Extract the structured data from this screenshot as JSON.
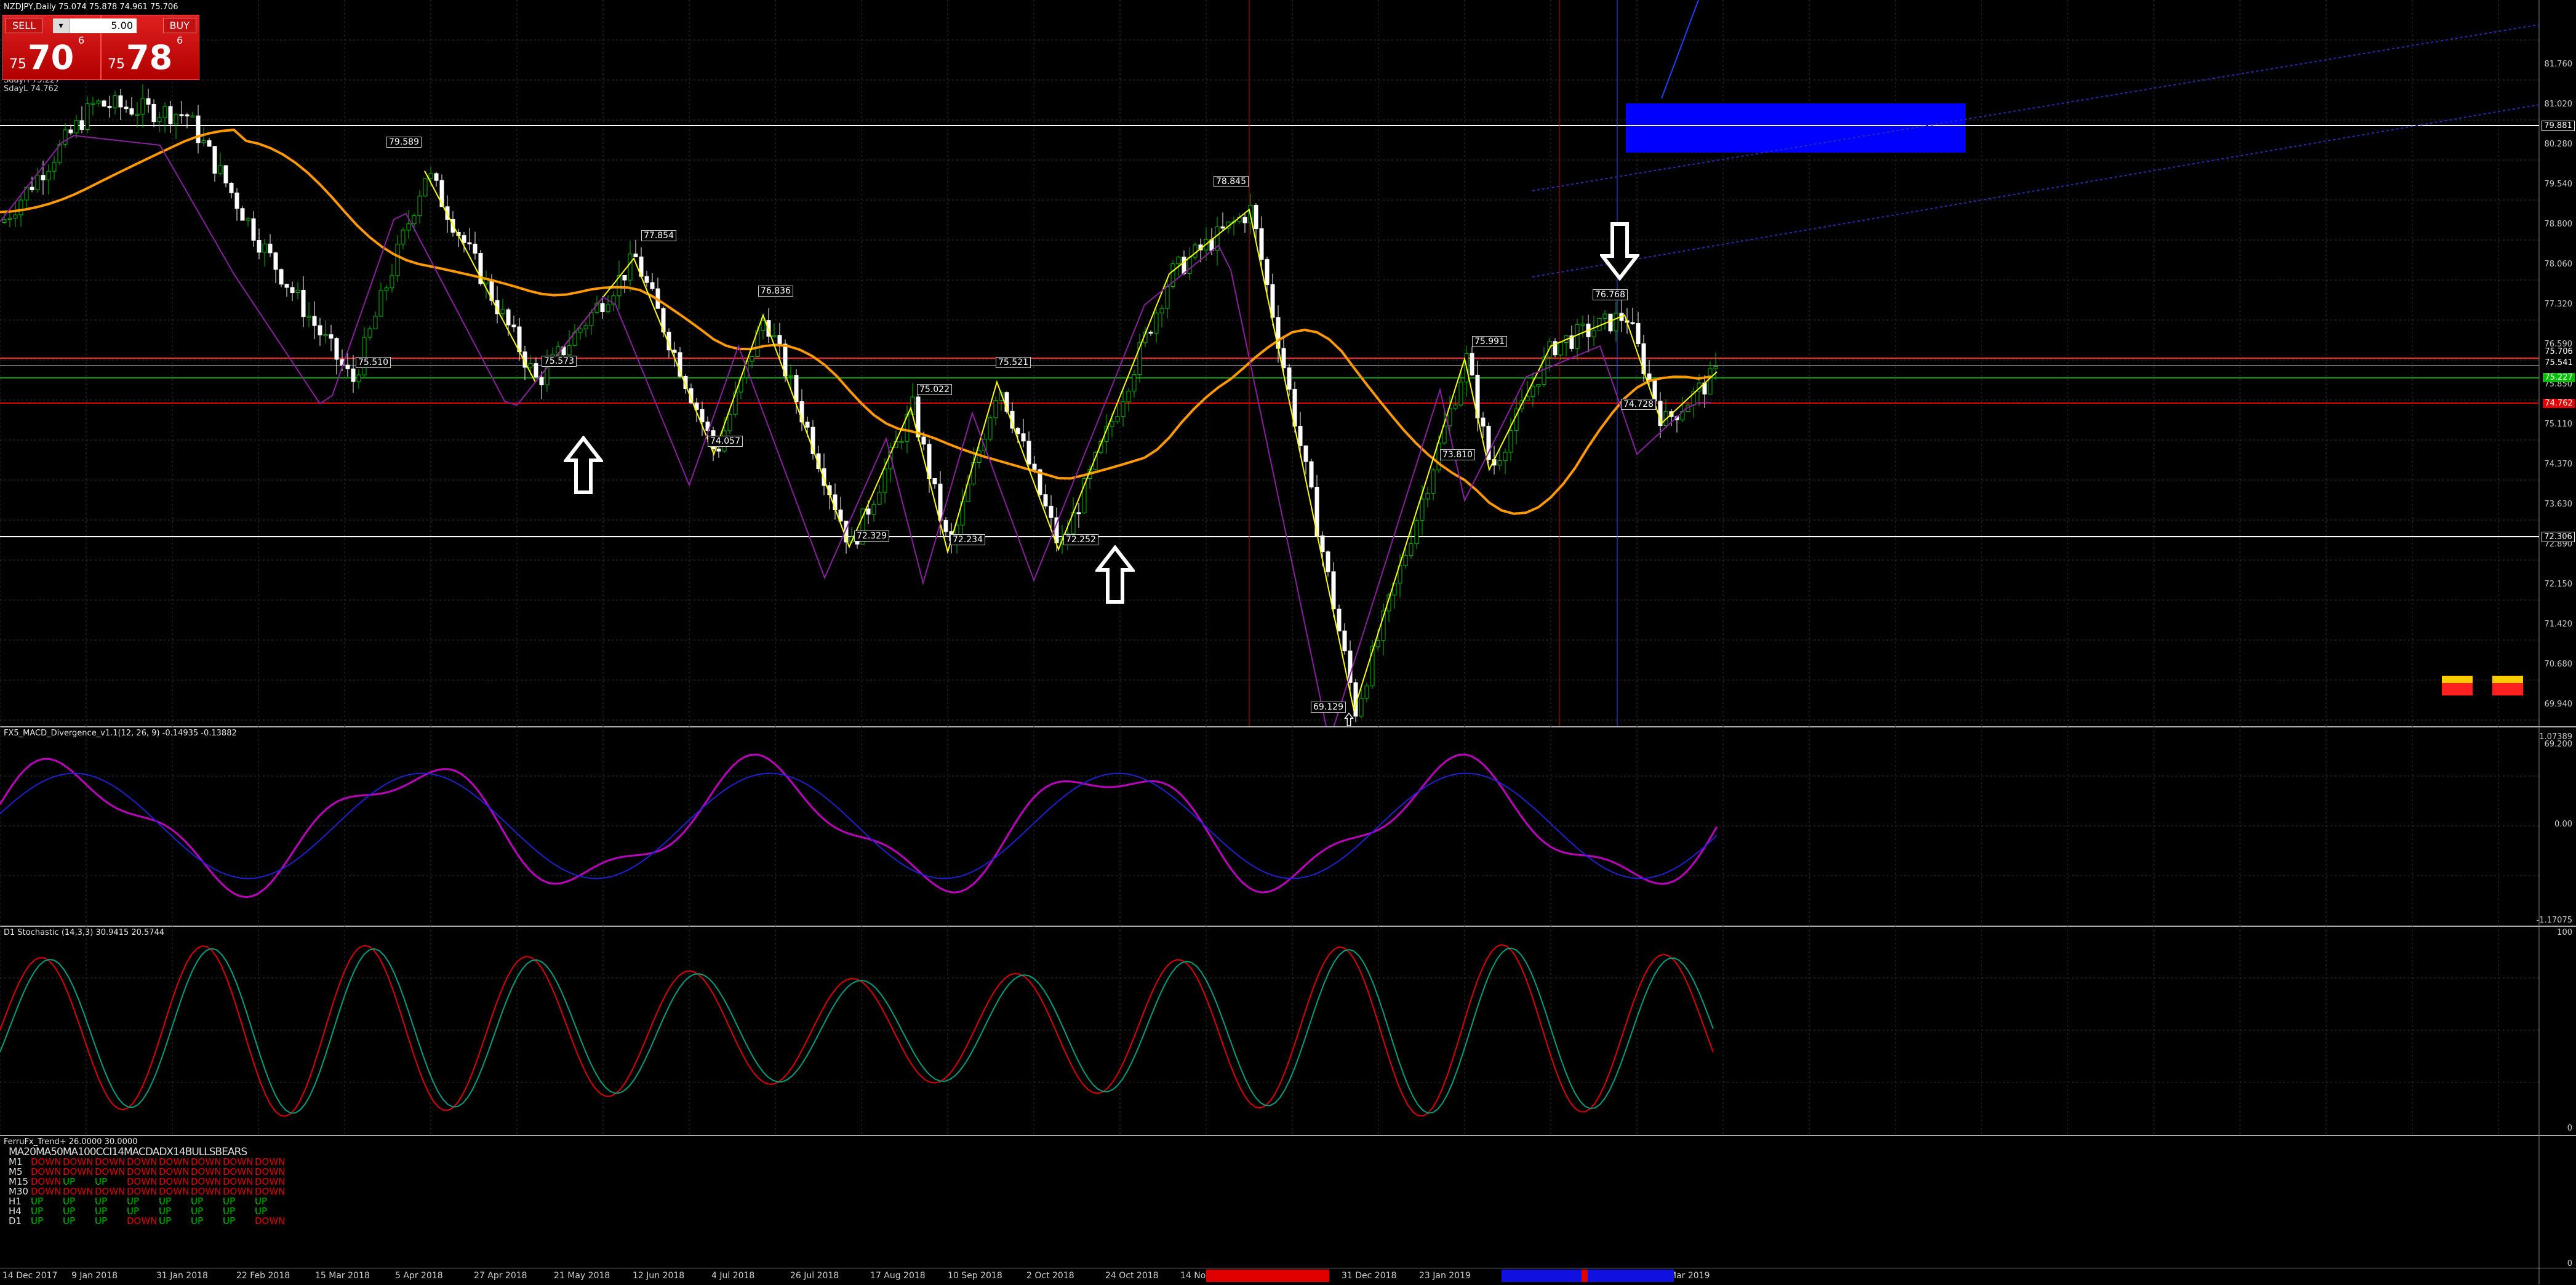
{
  "symbol_header": "NZDJPY,Daily  75.074 75.878 74.961 75.706",
  "trade_panel": {
    "sell_label": "SELL",
    "buy_label": "BUY",
    "lot": "5.00",
    "sell_small": "75",
    "sell_big": "70",
    "sell_sup": "6",
    "buy_small": "75",
    "buy_big": "78",
    "buy_sup": "6"
  },
  "sd_lines": [
    "SdayH 75.227",
    "SdayL 74.762"
  ],
  "price_axis": [
    "81.760",
    "81.020",
    "80.280",
    "79.540",
    "78.800",
    "78.060",
    "77.320",
    "76.590",
    "75.850",
    "75.110",
    "74.370",
    "73.630",
    "72.890",
    "72.150",
    "71.420",
    "70.680",
    "69.940",
    "69.200"
  ],
  "price_tags": {
    "top": "79.881",
    "current": "75.706",
    "line2": "75.541",
    "green": "75.227",
    "red": "74.762",
    "low": "72.306"
  },
  "zigzag_labels": [
    "79.589",
    "75.510",
    "77.854",
    "75.573",
    "76.836",
    "74.057",
    "75.022",
    "72.329",
    "72.234",
    "75.521",
    "72.252",
    "78.845",
    "69.129",
    "75.991",
    "73.810",
    "76.768",
    "74.728"
  ],
  "colors": {
    "bull_candle": "#00c000",
    "bear_candle": "#ffffff",
    "ma_orange": "#ff9900",
    "zigzag_yellow": "#ffff00",
    "zigzag_blue": "#3a70ff",
    "zigzag_red": "#ff2060",
    "rect_blue": "#0000ff",
    "macd_main": "#c000c0",
    "macd_signal": "#2020d0",
    "stoch_main": "#e00000",
    "stoch_signal": "#00a080"
  },
  "macd": {
    "title": "FX5_MACD_Divergence_v1.1(12, 26, 9) -0.14935 -0.13882",
    "axis": [
      "1.07389",
      "0.00",
      "-1.17075"
    ]
  },
  "stoch": {
    "title": "D1 Stochastic (14,3,3) 30.9415 20.5744",
    "axis": [
      "100",
      "0"
    ]
  },
  "trend": {
    "title": "FerruFx_Trend+ 26.0000 30.0000",
    "axis": "0",
    "headers": [
      "MA20",
      "MA50",
      "MA100",
      "CCI14",
      "MACD",
      "ADX14",
      "BULLS",
      "BEARS"
    ],
    "rows": [
      {
        "tf": "M1",
        "vals": [
          "DOWN",
          "DOWN",
          "DOWN",
          "DOWN",
          "DOWN",
          "DOWN",
          "DOWN",
          "DOWN"
        ]
      },
      {
        "tf": "M5",
        "vals": [
          "DOWN",
          "DOWN",
          "DOWN",
          "DOWN",
          "DOWN",
          "DOWN",
          "DOWN",
          "DOWN"
        ]
      },
      {
        "tf": "M15",
        "vals": [
          "DOWN",
          "UP",
          "UP",
          "DOWN",
          "DOWN",
          "DOWN",
          "DOWN",
          "DOWN"
        ]
      },
      {
        "tf": "M30",
        "vals": [
          "DOWN",
          "DOWN",
          "DOWN",
          "DOWN",
          "DOWN",
          "DOWN",
          "DOWN",
          "DOWN"
        ]
      },
      {
        "tf": "H1",
        "vals": [
          "UP",
          "UP",
          "UP",
          "UP",
          "UP",
          "UP",
          "UP",
          "UP"
        ]
      },
      {
        "tf": "H4",
        "vals": [
          "UP",
          "UP",
          "UP",
          "UP",
          "UP",
          "UP",
          "UP",
          "UP"
        ]
      },
      {
        "tf": "D1",
        "vals": [
          "UP",
          "UP",
          "UP",
          "DOWN",
          "UP",
          "UP",
          "UP",
          "DOWN"
        ]
      }
    ]
  },
  "date_axis": [
    "14 Dec 2017",
    "9 Jan 2018",
    "31 Jan 2018",
    "22 Feb 2018",
    "15 Mar 2018",
    "5 Apr 2018",
    "27 Apr 2018",
    "21 May 2018",
    "12 Jun 2018",
    "4 Jul 2018",
    "26 Jul 2018",
    "17 Aug 2018",
    "10 Sep 2018",
    "2 Oct 2018",
    "24 Oct 2018",
    "14 Nov",
    "2018",
    "31 Dec 2018",
    "23 Jan 2019",
    "Mar 2019"
  ]
}
